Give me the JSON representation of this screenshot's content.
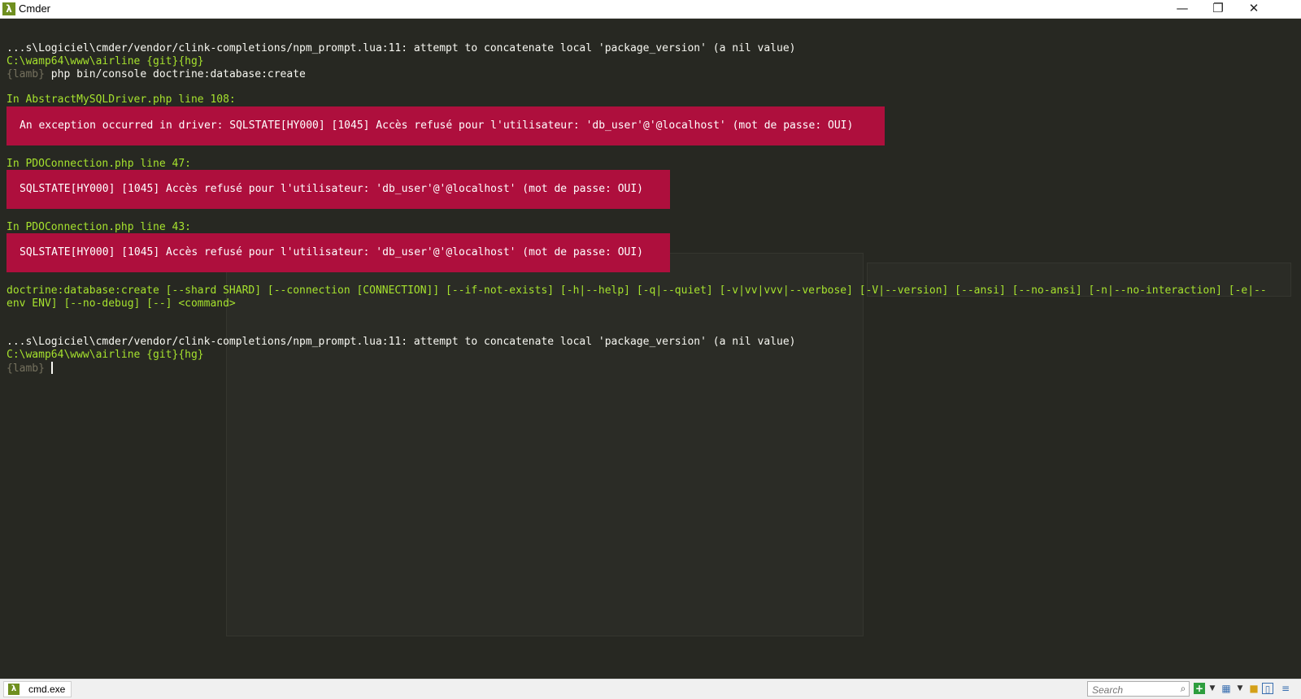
{
  "window": {
    "title": "Cmder",
    "app_icon_glyph": "λ",
    "controls": {
      "minimize": "—",
      "restore": "❐",
      "close": "✕"
    }
  },
  "console": {
    "line1": "...s\\Logiciel\\cmder/vendor/clink-completions/npm_prompt.lua:11: attempt to concatenate local 'package_version' (a nil value)",
    "path1": "C:\\wamp64\\www\\airline {git}{hg}",
    "prompt1": "{lamb} ",
    "command1": "php bin/console doctrine:database:create",
    "err1_header": "In AbstractMySQLDriver.php line 108:",
    "err1_message": "An exception occurred in driver: SQLSTATE[HY000] [1045] Accès refusé pour l'utilisateur: 'db_user'@'@localhost' (mot de passe: OUI)",
    "err2_header": "In PDOConnection.php line 47:",
    "err2_message": "SQLSTATE[HY000] [1045] Accès refusé pour l'utilisateur: 'db_user'@'@localhost' (mot de passe: OUI)",
    "err3_header": "In PDOConnection.php line 43:",
    "err3_message": "SQLSTATE[HY000] [1045] Accès refusé pour l'utilisateur: 'db_user'@'@localhost' (mot de passe: OUI)",
    "usage_line1": "doctrine:database:create [--shard SHARD] [--connection [CONNECTION]] [--if-not-exists] [-h|--help] [-q|--quiet] [-v|vv|vvv|--verbose] [-V|--version] [--ansi] [--no-ansi] [-n|--no-interaction] [-e|--",
    "usage_line2": "env ENV] [--no-debug] [--] <command>",
    "line2": "...s\\Logiciel\\cmder/vendor/clink-completions/npm_prompt.lua:11: attempt to concatenate local 'package_version' (a nil value)",
    "path2": "C:\\wamp64\\www\\airline {git}{hg}",
    "prompt2": "{lamb}"
  },
  "statusbar": {
    "tab_label": "cmd.exe",
    "search_placeholder": "Search",
    "icons": [
      "search-icon",
      "new-console-icon",
      "dropdown-icon",
      "layout-icon",
      "lock-icon",
      "tile-icon",
      "menu-icon"
    ]
  },
  "colors": {
    "background": "#272822",
    "text": "#f8f8f2",
    "prompt_path": "#a6e22e",
    "prompt_lamb": "#75715e",
    "error_block": "#ae0f3d"
  }
}
